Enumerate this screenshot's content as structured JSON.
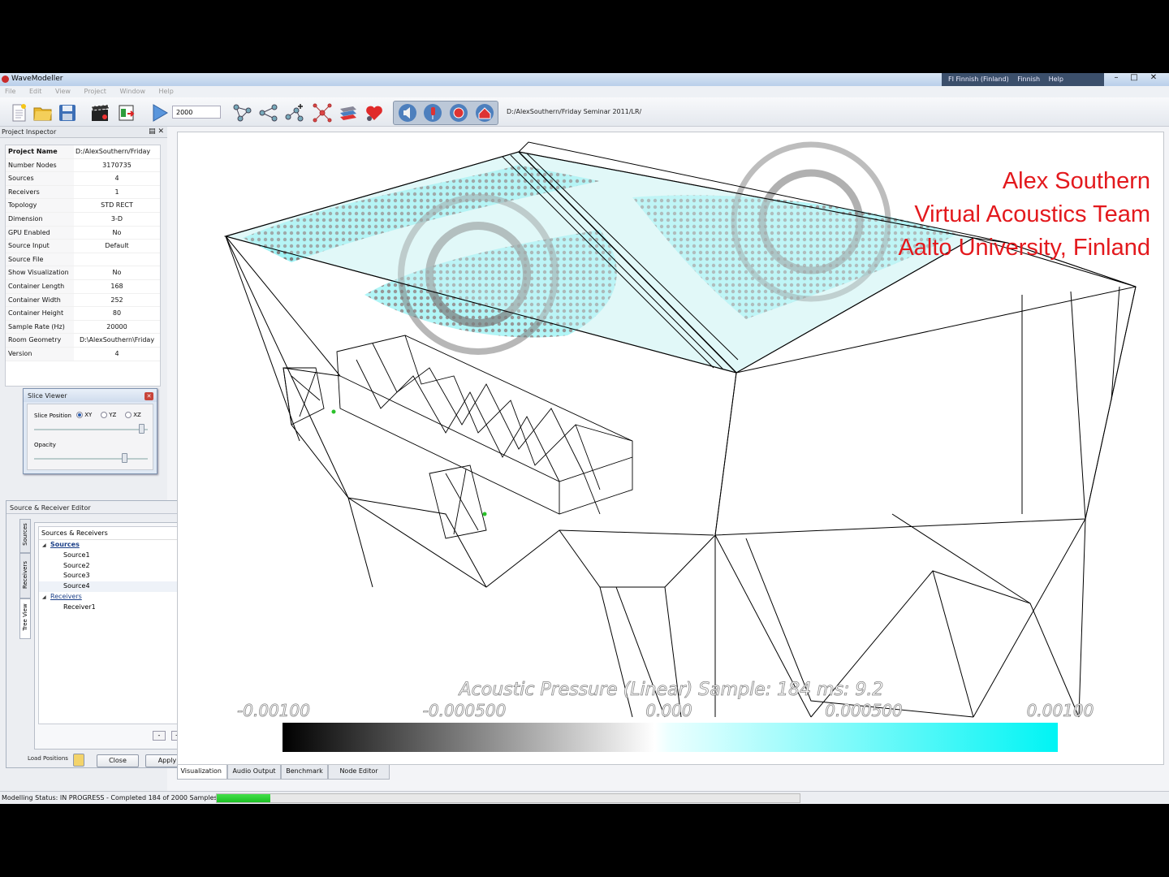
{
  "window": {
    "title": "WaveModeller",
    "language_bar": [
      "FI Finnish (Finland)",
      "Finnish",
      "Help"
    ]
  },
  "menu": [
    "File",
    "Edit",
    "View",
    "Project",
    "Window",
    "Help"
  ],
  "toolbar": {
    "samples_value": "2000",
    "project_path": "D:/AlexSouthern/Friday Seminar 2011/LR/",
    "icons": [
      "new-document-icon",
      "open-folder-icon",
      "save-icon",
      "clapperboard-icon",
      "export-icon",
      "play-icon",
      "graph-nodes-icon",
      "graph-branch-icon",
      "graph-add-icon",
      "network-icon",
      "layers-icon",
      "heart-node-icon",
      "speaker-icon",
      "microphone-icon",
      "sphere-icon",
      "house-icon"
    ]
  },
  "inspector": {
    "title": "Project Inspector",
    "rows": [
      {
        "key": "Project Name",
        "value": "D:/AlexSouthern/Friday"
      },
      {
        "key": "Number Nodes",
        "value": "3170735"
      },
      {
        "key": "Sources",
        "value": "4"
      },
      {
        "key": "Receivers",
        "value": "1"
      },
      {
        "key": "Topology",
        "value": "STD RECT"
      },
      {
        "key": "Dimension",
        "value": "3-D"
      },
      {
        "key": "GPU Enabled",
        "value": "No"
      },
      {
        "key": "Source Input",
        "value": "Default"
      },
      {
        "key": "Source File",
        "value": ""
      },
      {
        "key": "Show Visualization",
        "value": "No"
      },
      {
        "key": "Container Length",
        "value": "168"
      },
      {
        "key": "Container Width",
        "value": "252"
      },
      {
        "key": "Container Height",
        "value": "80"
      },
      {
        "key": "Sample Rate (Hz)",
        "value": "20000"
      },
      {
        "key": "Room Geometry",
        "value": "D:\\AlexSouthern\\Friday"
      },
      {
        "key": "Version",
        "value": "4"
      }
    ]
  },
  "slice_viewer": {
    "title": "Slice Viewer",
    "slice_position_label": "Slice Position",
    "options": [
      "XY",
      "YZ",
      "XZ"
    ],
    "selected": "XY",
    "opacity_label": "Opacity",
    "slice_level": 0.95,
    "opacity_level": 0.8
  },
  "sr_editor": {
    "title": "Source & Receiver Editor",
    "tabs": [
      "Sources",
      "Receivers",
      "Tree View"
    ],
    "tree_header": "Sources & Receivers",
    "groups": [
      {
        "name": "Sources",
        "items": [
          "Source1",
          "Source2",
          "Source3",
          "Source4"
        ]
      },
      {
        "name": "Receivers",
        "items": [
          "Receiver1"
        ]
      }
    ],
    "minus": "-",
    "plus": "+",
    "load_positions": "Load Positions",
    "close": "Close",
    "apply": "Apply"
  },
  "overlay": {
    "line1": "Alex Southern",
    "line2": "Virtual Acoustics Team",
    "line3": "Aalto University, Finland",
    "color": "#e3191d"
  },
  "colorbar": {
    "title": "Acoustic Pressure (Linear) Sample: 184 ms: 9.2",
    "ticks": [
      "-0.00100",
      "-0.000500",
      "0.000",
      "0.000500",
      "0.00100"
    ],
    "negative_color": "#000000",
    "positive_color": "#00f0f0"
  },
  "bottom_tabs": [
    "Visualization",
    "Audio Output",
    "Benchmark",
    "Node Editor"
  ],
  "status": {
    "text": "Modelling Status: IN PROGRESS - Completed 184 of 2000 Samples",
    "completed": 184,
    "total": 2000
  }
}
